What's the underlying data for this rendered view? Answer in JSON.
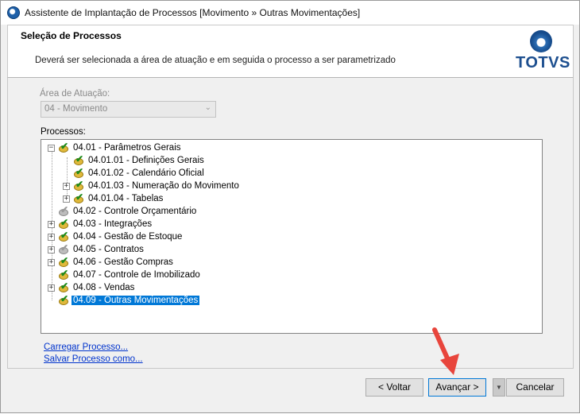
{
  "window": {
    "title": "Assistente de Implantação de Processos [Movimento » Outras Movimentações]"
  },
  "header": {
    "title": "Seleção de Processos",
    "subtitle": "Deverá ser selecionada a área de atuação e em seguida o processo a ser parametrizado",
    "logo_text": "TOTVS"
  },
  "area": {
    "label": "Área de Atuação:",
    "selected": "04 - Movimento"
  },
  "processes": {
    "label": "Processos:",
    "items": [
      {
        "label": "04.01 - Parâmetros Gerais",
        "level": 0,
        "expander": "−",
        "state": "checked"
      },
      {
        "label": "04.01.01 - Definições Gerais",
        "level": 1,
        "expander": "",
        "state": "checked"
      },
      {
        "label": "04.01.02 - Calendário Oficial",
        "level": 1,
        "expander": "",
        "state": "checked"
      },
      {
        "label": "04.01.03 - Numeração do Movimento",
        "level": 1,
        "expander": "+",
        "state": "checked"
      },
      {
        "label": "04.01.04 - Tabelas",
        "level": 1,
        "expander": "+",
        "state": "checked"
      },
      {
        "label": "04.02 - Controle Orçamentário",
        "level": 0,
        "expander": "",
        "state": "partial"
      },
      {
        "label": "04.03 - Integrações",
        "level": 0,
        "expander": "+",
        "state": "checked"
      },
      {
        "label": "04.04 - Gestão de Estoque",
        "level": 0,
        "expander": "+",
        "state": "checked"
      },
      {
        "label": "04.05 - Contratos",
        "level": 0,
        "expander": "+",
        "state": "partial"
      },
      {
        "label": "04.06 - Gestão Compras",
        "level": 0,
        "expander": "+",
        "state": "checked"
      },
      {
        "label": "04.07 - Controle de Imobilizado",
        "level": 0,
        "expander": "",
        "state": "checked"
      },
      {
        "label": "04.08 - Vendas",
        "level": 0,
        "expander": "+",
        "state": "checked"
      },
      {
        "label": "04.09 - Outras Movimentações",
        "level": 0,
        "expander": "",
        "state": "checked",
        "selected": true
      }
    ]
  },
  "links": {
    "load": "Carregar Processo...",
    "save": "Salvar Processo como..."
  },
  "buttons": {
    "back": "< Voltar",
    "next": "Avançar >",
    "cancel": "Cancelar"
  },
  "annotation": {
    "arrow_color": "#e8453c"
  }
}
